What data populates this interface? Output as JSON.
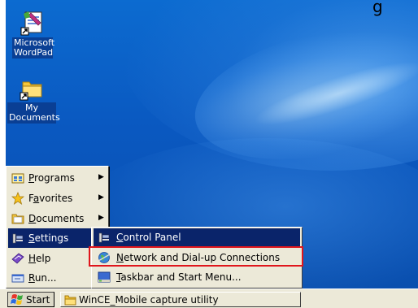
{
  "edge_text": "g",
  "desktop": {
    "icons": [
      {
        "label_line1": "Microsoft",
        "label_line2": "WordPad",
        "icon": "wordpad-icon"
      },
      {
        "label_line1": "My",
        "label_line2": "Documents",
        "icon": "folder-icon"
      }
    ]
  },
  "start_menu": {
    "items": [
      {
        "label": "Programs",
        "access": "P",
        "rest": "rograms",
        "icon": "programs-icon",
        "has_submenu": true
      },
      {
        "label": "Favorites",
        "access_pre": "F",
        "access": "a",
        "rest": "vorites",
        "icon": "star-icon",
        "has_submenu": true
      },
      {
        "label": "Documents",
        "access": "D",
        "rest": "ocuments",
        "icon": "documents-icon",
        "has_submenu": true
      },
      {
        "label": "Settings",
        "access": "S",
        "rest": "ettings",
        "icon": "settings-icon",
        "has_submenu": true,
        "selected": true
      },
      {
        "label": "Help",
        "access": "H",
        "rest": "elp",
        "icon": "help-icon"
      },
      {
        "label": "Run...",
        "access": "R",
        "rest": "un...",
        "icon": "run-icon"
      }
    ]
  },
  "settings_submenu": {
    "items": [
      {
        "label": "Control Panel",
        "access": "C",
        "rest": "ontrol Panel",
        "icon": "control-panel-icon"
      },
      {
        "label": "Network and Dial-up Connections",
        "access": "N",
        "rest": "etwork and Dial-up Connections",
        "icon": "network-globe-icon",
        "selected": true
      },
      {
        "label": "Taskbar and Start Menu...",
        "access": "T",
        "rest": "askbar and Start Menu...",
        "icon": "taskbar-icon"
      }
    ]
  },
  "taskbar": {
    "start_label": "Start",
    "task_label": "WinCE_Mobile capture utility"
  },
  "colors": {
    "desktop": "#0a58c0",
    "menu_bg": "#ece9d8",
    "selection": "#0a246a",
    "highlight_box": "#e0161c"
  }
}
